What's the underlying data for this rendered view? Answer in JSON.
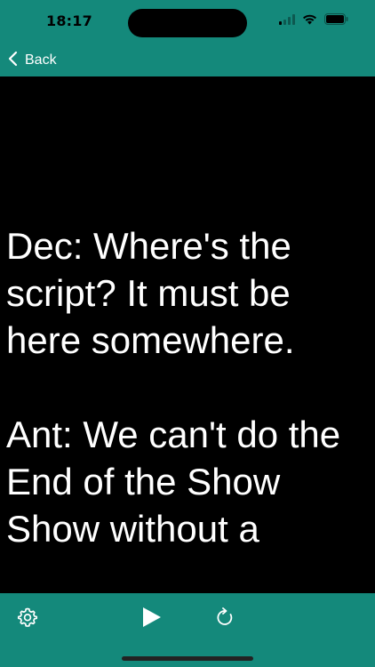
{
  "status_bar": {
    "time": "18:17"
  },
  "nav": {
    "back_label": "Back"
  },
  "script": {
    "text": "Dec: Where's the script? It must be here somewhere.\n\nAnt: We can't do the End of the Show Show without a"
  },
  "toolbar": {
    "settings_icon": "gear-icon",
    "play_icon": "play-icon",
    "refresh_icon": "refresh-icon"
  },
  "colors": {
    "teal": "#14897b",
    "background": "#000000",
    "text": "#ffffff"
  }
}
